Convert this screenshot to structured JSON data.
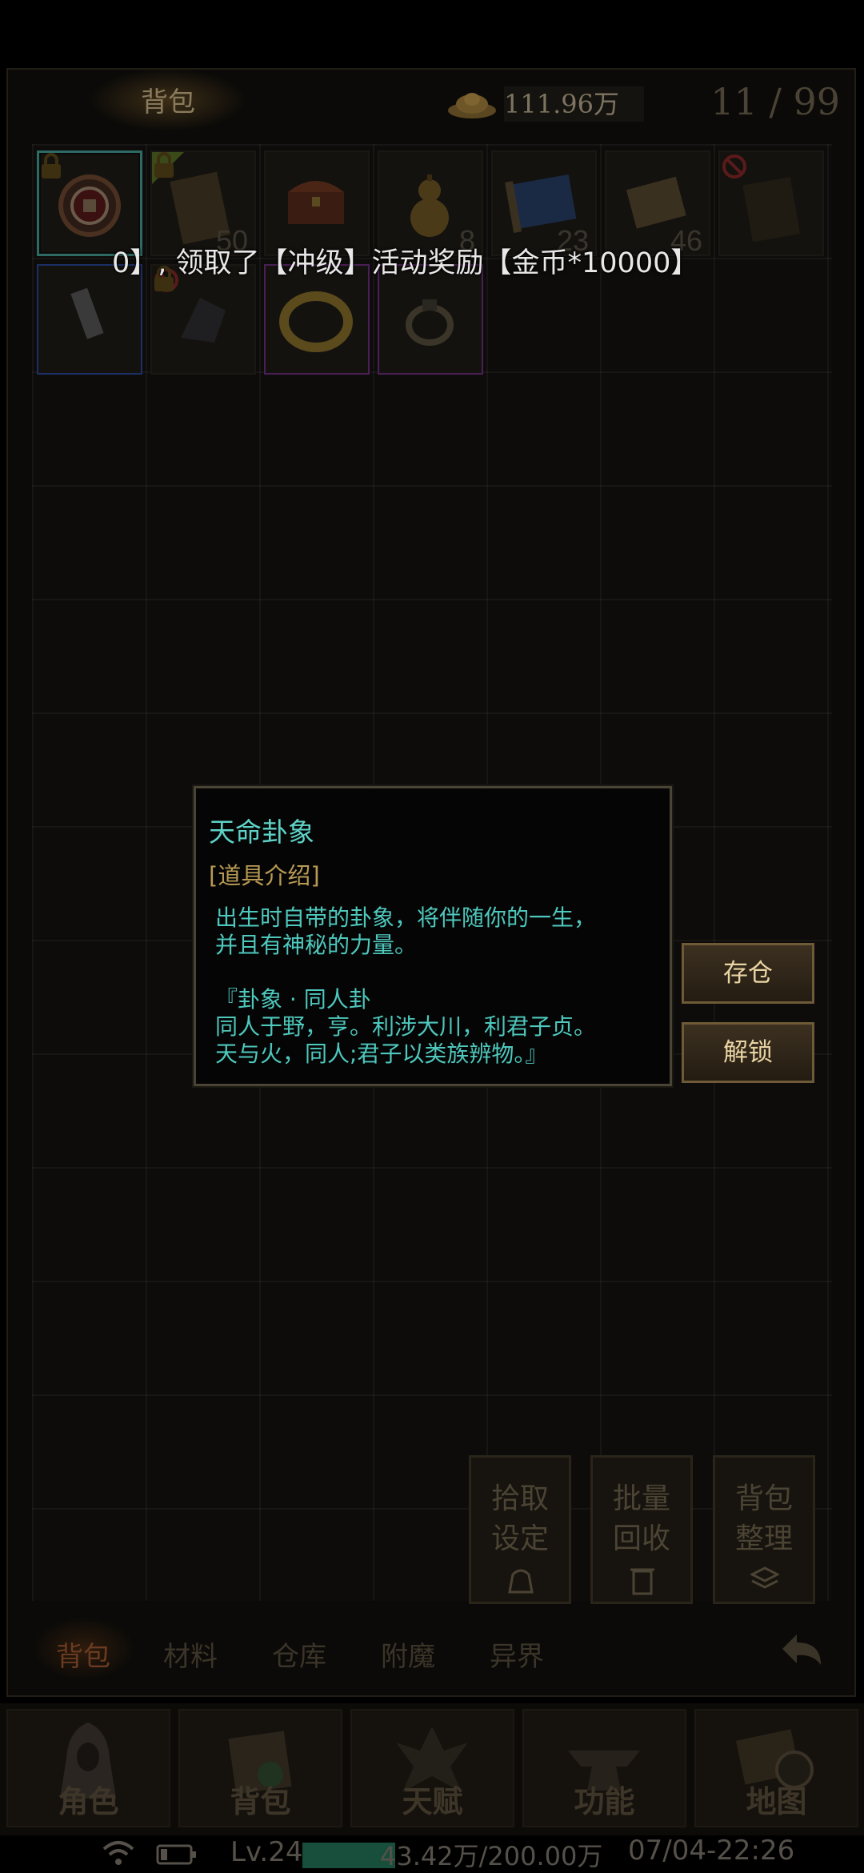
{
  "header": {
    "title": "背包",
    "gold": "111.96万",
    "capacity": "11 / 99"
  },
  "items": [
    {
      "name": "seal",
      "count": ""
    },
    {
      "name": "book",
      "count": "50"
    },
    {
      "name": "chest",
      "count": ""
    },
    {
      "name": "gourd",
      "count": "8"
    },
    {
      "name": "scroll-blue",
      "count": "23"
    },
    {
      "name": "scroll",
      "count": "46"
    },
    {
      "name": "book-dark",
      "count": ""
    },
    {
      "name": "whetstone",
      "count": ""
    },
    {
      "name": "gauntlet",
      "count": ""
    },
    {
      "name": "golden-ring",
      "count": ""
    },
    {
      "name": "iron-ring",
      "count": ""
    }
  ],
  "broadcast": "0】, 领取了【冲级】活动奖励【金币*10000】",
  "tooltip": {
    "name": "天命卦象",
    "section": "[道具介绍]",
    "desc1": "出生时自带的卦象，将伴随你的一生，",
    "desc2": "并且有神秘的力量。",
    "gua_title": "『卦象 · 同人卦",
    "gua1": "同人于野，亨。利涉大川，利君子贞。",
    "gua2": "天与火，同人;君子以类族辨物。』"
  },
  "side_buttons": {
    "store": "存仓",
    "unlock": "解锁"
  },
  "actions": {
    "pickup": [
      "拾取",
      "设定"
    ],
    "recycle": [
      "批量",
      "回收"
    ],
    "sort": [
      "背包",
      "整理"
    ]
  },
  "tabs": [
    "背包",
    "材料",
    "仓库",
    "附魔",
    "异界"
  ],
  "nav": [
    "角色",
    "背包",
    "天赋",
    "功能",
    "地图"
  ],
  "status": {
    "level": "Lv.24",
    "exp": "43.42万/200.00万",
    "exp_fraction": 0.217,
    "time": "07/04-22:26"
  }
}
